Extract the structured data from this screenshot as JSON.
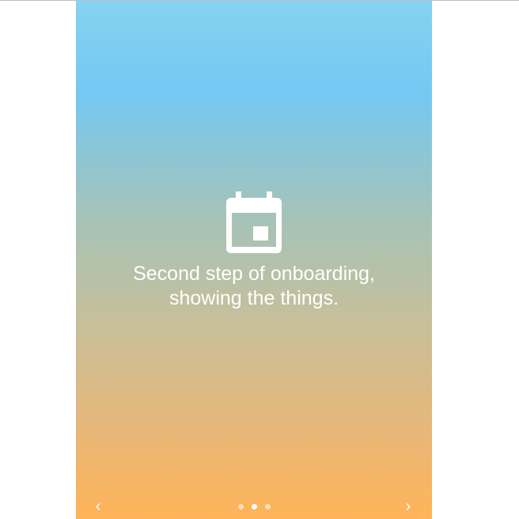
{
  "onboarding": {
    "caption": "Second step of onboarding,\nshowing the things.",
    "icon": "calendar-icon",
    "prev_glyph": "‹",
    "next_glyph": "›",
    "step_count": 3,
    "active_step": 2
  },
  "colors": {
    "gradient_top": "#86d2f1",
    "gradient_bottom": "#ffb459",
    "text": "#ffffff"
  }
}
